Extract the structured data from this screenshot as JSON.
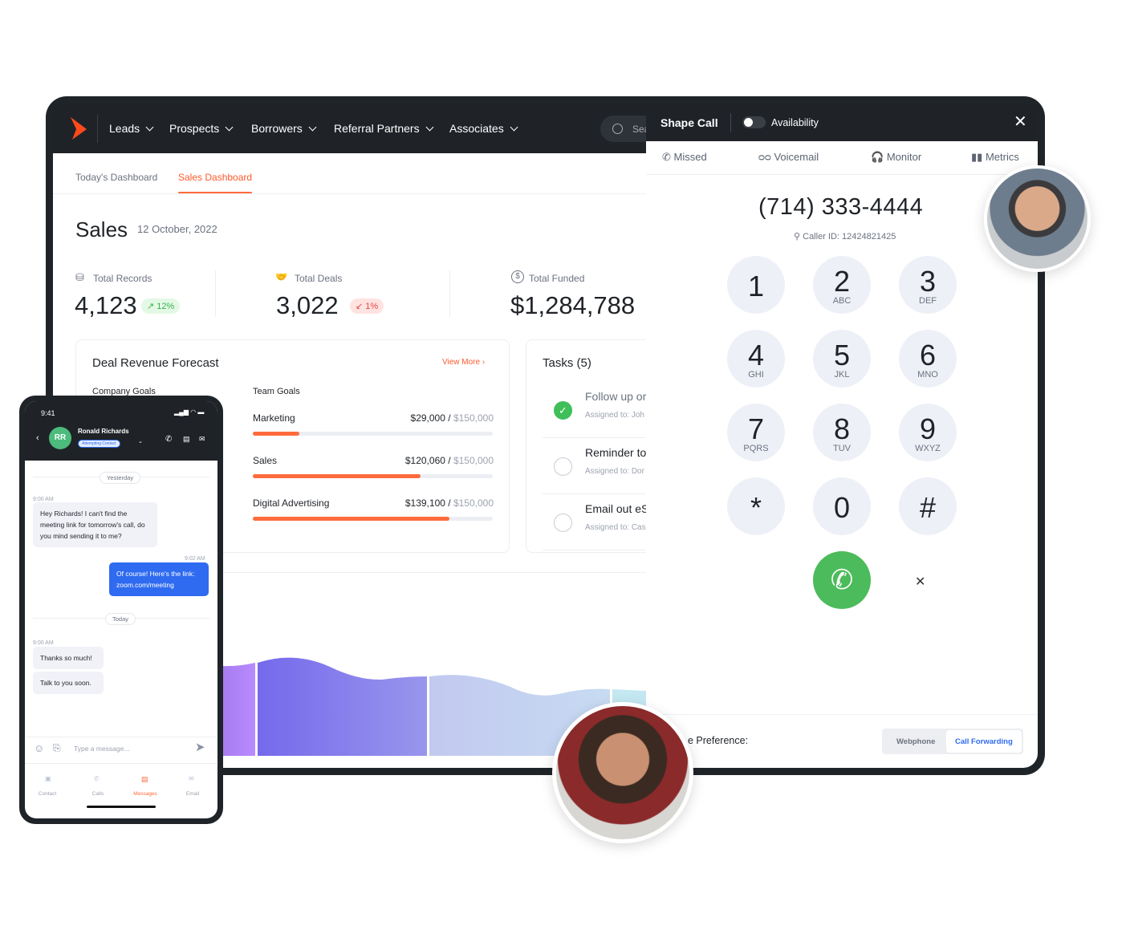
{
  "nav": {
    "items": [
      "Leads",
      "Prospects",
      "Borrowers",
      "Referral Partners",
      "Associates"
    ],
    "search_placeholder": "Search"
  },
  "tabs": {
    "today": "Today's Dashboard",
    "sales": "Sales Dashboard"
  },
  "page": {
    "title": "Sales",
    "date": "12 October, 2022"
  },
  "stats": [
    {
      "label": "Total Records",
      "value": "4,123",
      "change": "12%",
      "direction": "up"
    },
    {
      "label": "Total Deals",
      "value": "3,022",
      "change": "1%",
      "direction": "down"
    },
    {
      "label": "Total Funded",
      "value": "$1,284,788"
    }
  ],
  "forecast": {
    "title": "Deal Revenue Forecast",
    "view_more": "View More",
    "company_goals": "Company Goals",
    "team_goals": "Team Goals",
    "goals": [
      {
        "name": "Marketing",
        "current": "$29,000",
        "target": "$150,000",
        "progress": 0.193
      },
      {
        "name": "Sales",
        "current": "$120,060",
        "target": "$150,000",
        "progress": 0.7
      },
      {
        "name": "Digital Advertising",
        "current": "$139,100",
        "target": "$150,000",
        "progress": 0.82
      }
    ]
  },
  "tasks": {
    "title": "Tasks (5)",
    "items": [
      {
        "title": "Follow up or",
        "assigned": "Assigned to: Joh",
        "done": true
      },
      {
        "title": "Reminder to",
        "assigned": "Assigned to: Dor",
        "done": false
      },
      {
        "title": "Email out eS",
        "assigned": "Assigned to: Cas",
        "done": false
      }
    ]
  },
  "call": {
    "title": "Shape Call",
    "availability": "Availability",
    "tabs": [
      "Missed",
      "Voicemail",
      "Monitor",
      "Metrics"
    ],
    "number": "(714) 333-4444",
    "caller_id": "Caller ID: 12424821425",
    "keys": [
      {
        "d": "1",
        "l": ""
      },
      {
        "d": "2",
        "l": "ABC"
      },
      {
        "d": "3",
        "l": "DEF"
      },
      {
        "d": "4",
        "l": "GHI"
      },
      {
        "d": "5",
        "l": "JKL"
      },
      {
        "d": "6",
        "l": "MNO"
      },
      {
        "d": "7",
        "l": "PQRS"
      },
      {
        "d": "8",
        "l": "TUV"
      },
      {
        "d": "9",
        "l": "WXYZ"
      },
      {
        "d": "*",
        "l": ""
      },
      {
        "d": "0",
        "l": ""
      },
      {
        "d": "#",
        "l": ""
      }
    ],
    "preference_label": "e Preference:",
    "pref_options": [
      "Webphone",
      "Call Forwarding"
    ],
    "pref_selected": "Call Forwarding"
  },
  "mobile": {
    "time": "9:41",
    "contact": "Ronald Richards",
    "initials": "RR",
    "status": "Attempting Contact",
    "messages": {
      "yesterday": "Yesterday",
      "today": "Today",
      "m1_time": "9:00 AM",
      "m1": "Hey Richards! I can't find the meeting link for tomorrow's call, do you mind sending it to me?",
      "m2_time": "9:02 AM",
      "m2": "Of course! Here's the link: zoom.com/meeting",
      "m3_time": "9:00 AM",
      "m3": "Thanks so much!",
      "m4": "Talk to you soon."
    },
    "input_placeholder": "Type a message...",
    "bottom_nav": [
      "Contact",
      "Calls",
      "Messages",
      "Email"
    ],
    "active_nav": "Messages"
  },
  "colors": {
    "accent": "#ff6b3d",
    "dark": "#1f2328",
    "green": "#4cbb5b",
    "blue": "#2f6bf0"
  }
}
